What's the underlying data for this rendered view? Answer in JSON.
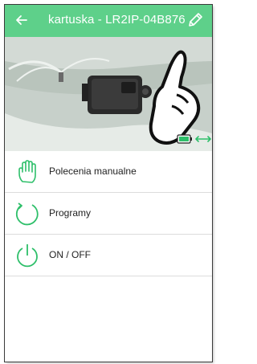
{
  "topbar": {
    "title": "kartuska - LR2IP-04B876",
    "back_icon": "arrow-left-icon",
    "edit_icon": "pencil-icon"
  },
  "status": {
    "battery_icon": "battery-icon",
    "link_icon": "double-arrow-icon"
  },
  "menu": {
    "items": [
      {
        "label": "Polecenia manualne",
        "icon": "hand-icon"
      },
      {
        "label": "Programy",
        "icon": "cycle-icon"
      },
      {
        "label": "ON / OFF",
        "icon": "power-icon"
      }
    ]
  },
  "colors": {
    "accent": "#5ed08a",
    "icon_green": "#2ebf6a",
    "text": "#222222"
  }
}
